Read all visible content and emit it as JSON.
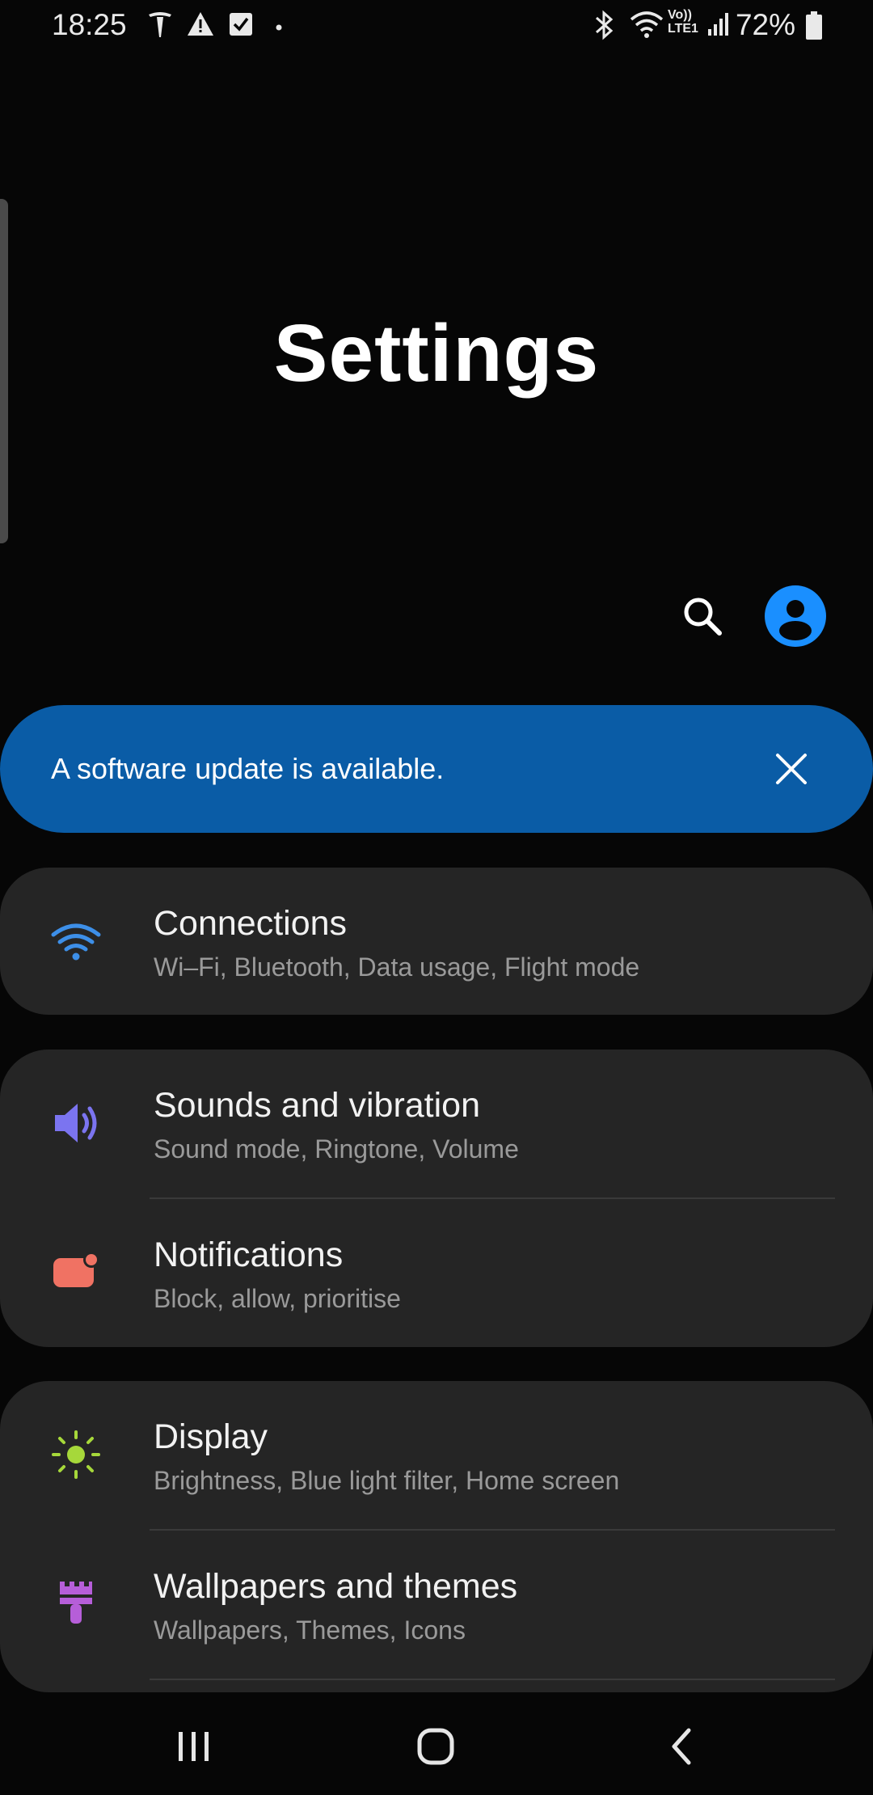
{
  "status_bar": {
    "time": "18:25",
    "battery_percent": "72%",
    "left_icons": [
      "tesla-icon",
      "warning-icon",
      "checkbox-icon",
      "dot-icon"
    ],
    "right_icons": [
      "bluetooth-icon",
      "wifi-icon",
      "volte-icon",
      "signal-icon",
      "battery-icon"
    ],
    "volte_label": "Vo))",
    "lte_label": "LTE1"
  },
  "header": {
    "title": "Settings"
  },
  "actions": {
    "search_icon": "search-icon",
    "account_icon": "account-icon",
    "avatar_color": "#1a8fff"
  },
  "banner": {
    "text": "A software update is available.",
    "close_icon": "close-icon",
    "color": "#0a5ca6"
  },
  "settings_items": [
    {
      "title": "Connections",
      "subtitle": "Wi–Fi, Bluetooth, Data usage, Flight mode",
      "icon": "wifi-icon",
      "color": "#3d8fe8"
    },
    {
      "title": "Sounds and vibration",
      "subtitle": "Sound mode, Ringtone, Volume",
      "icon": "speaker-icon",
      "color": "#7b74f0"
    },
    {
      "title": "Notifications",
      "subtitle": "Block, allow, prioritise",
      "icon": "notification-icon",
      "color": "#f07263"
    },
    {
      "title": "Display",
      "subtitle": "Brightness, Blue light filter, Home screen",
      "icon": "brightness-icon",
      "color": "#a6d83a"
    },
    {
      "title": "Wallpapers and themes",
      "subtitle": "Wallpapers, Themes, Icons",
      "icon": "paintbrush-icon",
      "color": "#b65ed9"
    }
  ],
  "nav_bar": {
    "buttons": [
      "recents-icon",
      "home-icon",
      "back-icon"
    ]
  }
}
